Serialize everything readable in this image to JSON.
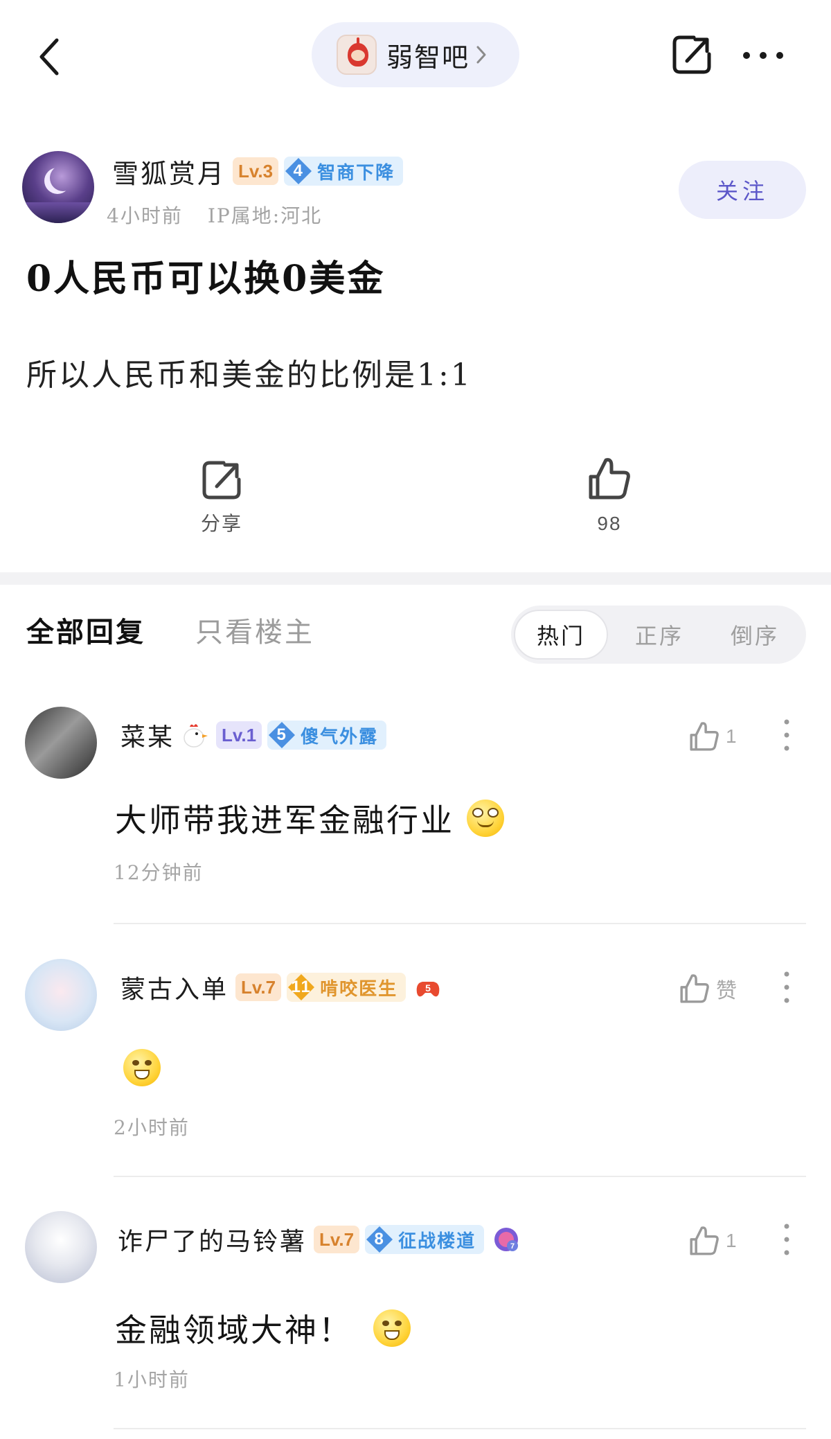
{
  "header": {
    "forum_name": "弱智吧"
  },
  "post": {
    "author": {
      "name": "雪狐赏月",
      "level": "Lv.3",
      "title_num": "4",
      "title": "智商下降"
    },
    "time": "4小时前",
    "ip": "IP属地:河北",
    "follow_label": "关注",
    "title": "0人民币可以换0美金",
    "body": "所以人民币和美金的比例是1:1",
    "share_label": "分享",
    "like_count": "98"
  },
  "replies": {
    "tab_all": "全部回复",
    "tab_op_only": "只看楼主",
    "sort_hot": "热门",
    "sort_asc": "正序",
    "sort_desc": "倒序"
  },
  "comments": [
    {
      "name": "菜某",
      "level": "Lv.1",
      "title_num": "5",
      "title": "傻气外露",
      "likes": "1",
      "text": "大师带我进军金融行业",
      "emoji": "dizzy-face-emoji",
      "time": "12分钟前"
    },
    {
      "name": "蒙古入单",
      "level": "Lv.7",
      "title_num": "11",
      "title": "啃咬医生",
      "likes": "赞",
      "text": "",
      "emoji": "grimace-emoji",
      "time": "2小时前"
    },
    {
      "name": "诈尸了的马铃薯",
      "level": "Lv.7",
      "title_num": "8",
      "title": "征战楼道",
      "likes": "1",
      "text": "金融领域大神！",
      "emoji": "grimace-emoji",
      "time": "1小时前"
    }
  ],
  "colors": {
    "accent": "#5c57c9",
    "pill_bg": "#eef0fb",
    "badge_blue": "#3b8fe0",
    "badge_orange": "#e0952d",
    "level_orange": "#d7822d",
    "level_purple": "#6a5fd0"
  }
}
